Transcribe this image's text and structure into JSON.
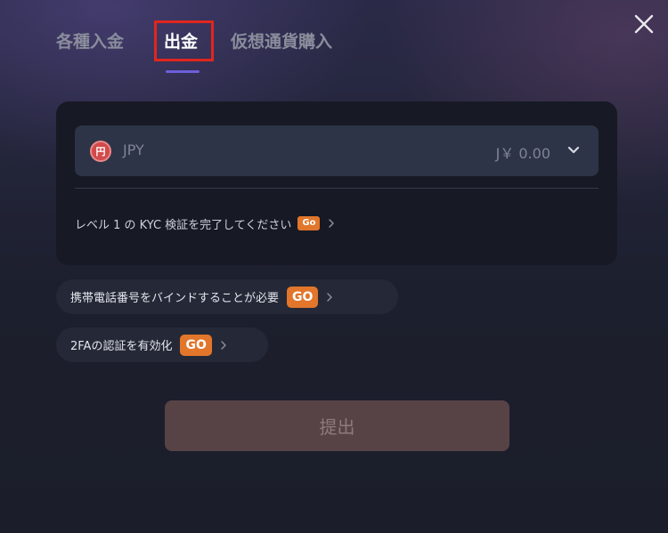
{
  "tabs": [
    {
      "label": "各種入金"
    },
    {
      "label": "出金",
      "active": true
    },
    {
      "label": "仮想通貨購入"
    }
  ],
  "currency": {
    "icon": "yen-icon",
    "icon_glyph": "円",
    "code": "JPY",
    "balance": "J￥ 0.00"
  },
  "kyc": {
    "text": "レベル 1 の KYC 検証を完了してください",
    "go_label": "Go"
  },
  "phone_requirement": {
    "text": "携帯電話番号をバインドすることが必要",
    "go_label": "GO"
  },
  "twofa_requirement": {
    "text": "2FAの認証を有効化",
    "go_label": "GO"
  },
  "submit_label": "提出",
  "colors": {
    "accent": "#e2762b",
    "tab_underline": "#6b5fd8",
    "highlight_box": "#e0261d",
    "submit_bg": "#574346"
  }
}
